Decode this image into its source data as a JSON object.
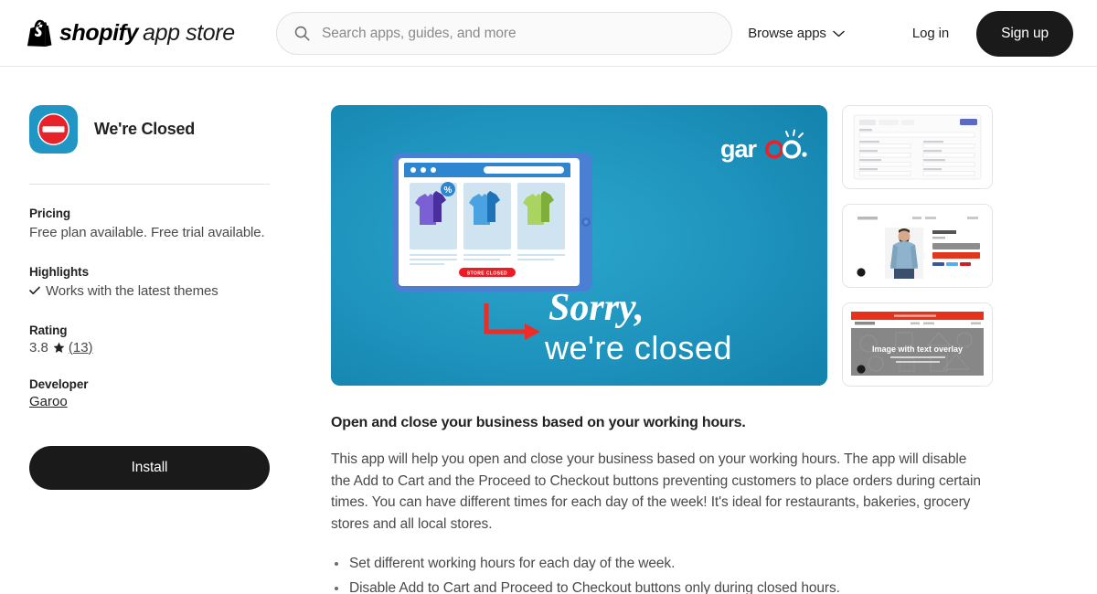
{
  "header": {
    "logo_mark": "shopify-bag-icon",
    "logo_bold": "shopify",
    "logo_light": "app store",
    "search": {
      "icon": "search-icon",
      "placeholder": "Search apps, guides, and more",
      "value": ""
    },
    "browse_apps_label": "Browse apps",
    "browse_apps_icon": "chevron-down-icon",
    "login_label": "Log in",
    "signup_label": "Sign up",
    "signup_bg": "#1a1a1a"
  },
  "sidebar": {
    "app_icon": {
      "name": "app-icon-no-entry",
      "bg": "#2196c4",
      "sign_color": "#e8222a"
    },
    "app_title": "We're Closed",
    "pricing": {
      "label": "Pricing",
      "value": "Free plan available. Free trial available."
    },
    "highlights": {
      "label": "Highlights",
      "icon": "check-icon",
      "items": [
        "Works with the latest themes"
      ]
    },
    "rating": {
      "label": "Rating",
      "score": "3.8",
      "star_icon": "star-icon",
      "count": "(13)"
    },
    "developer": {
      "label": "Developer",
      "name": "Garoo"
    },
    "install_label": "Install"
  },
  "main": {
    "hero": {
      "name": "hero-media-sorry-we-are-closed",
      "bg_color": "#1b92bd",
      "brand_logo": "garoo.",
      "brand_logo_accent": "#e8222a",
      "headline_script": "Sorry,",
      "headline_sans": "we're closed",
      "device": "tablet-browser-mockup",
      "store_button_label": "STORE CLOSED",
      "store_button_color": "#ed1c24",
      "discount_badge": "%",
      "product_count": 3,
      "product_colors": [
        "#6a4fc4",
        "#2e86d0",
        "#9ccb59"
      ],
      "arrow_icon": "red-arrow-icon"
    },
    "thumbnails": [
      {
        "name": "thumbnail-app-settings-form",
        "alt": "App settings screen with opening and closing time fields"
      },
      {
        "name": "thumbnail-product-page",
        "alt": "Storefront product page with disabled add to cart button"
      },
      {
        "name": "thumbnail-storefront-banner",
        "alt": "Storefront homepage with closed banner and image with text overlay",
        "overlay_text": "Image with text overlay"
      }
    ],
    "description_title": "Open and close your business based on your working hours.",
    "description_body": "This app will help you open and close your business based on your working hours. The app will disable the Add to Cart and the Proceed to Checkout buttons preventing customers to place orders during certain times. You can have different times for each day of the week! It's ideal for restaurants, bakeries, grocery stores and all local stores.",
    "bullets": [
      "Set different working hours for each day of the week.",
      "Disable Add to Cart and Proceed to Checkout buttons only during closed hours."
    ]
  }
}
